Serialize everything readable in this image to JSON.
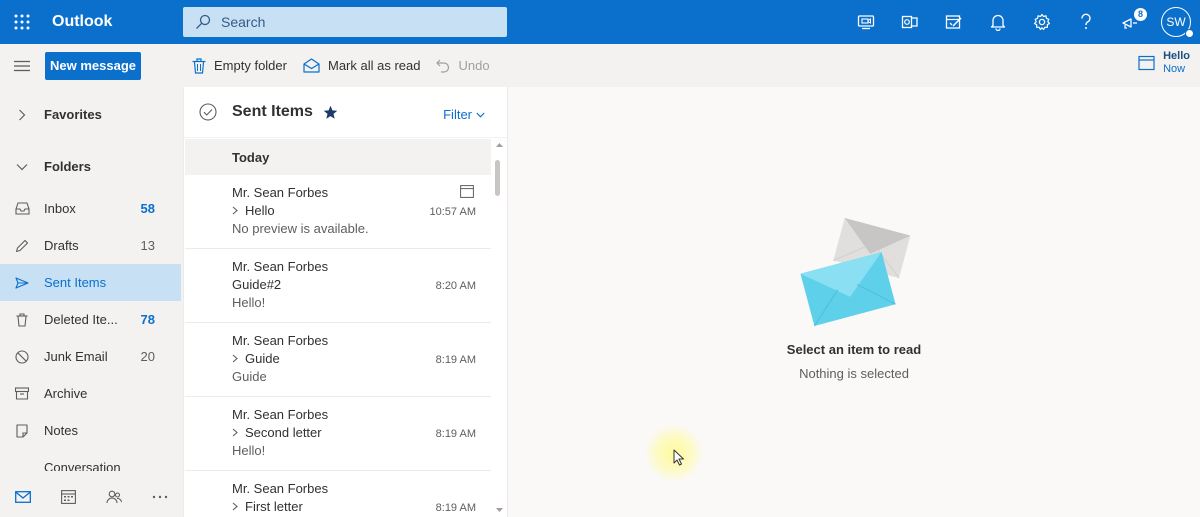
{
  "app": {
    "title": "Outlook"
  },
  "search": {
    "placeholder": "Search"
  },
  "topbar": {
    "notifications_badge": "8",
    "avatar_initials": "SW"
  },
  "toolbar": {
    "new_message": "New message",
    "empty_folder": "Empty folder",
    "mark_all_read": "Mark all as read",
    "undo": "Undo",
    "calendar_title": "Hello",
    "calendar_time": "Now"
  },
  "nav": {
    "favorites": "Favorites",
    "folders": "Folders",
    "items": [
      {
        "label": "Inbox",
        "count": "58",
        "bold": true
      },
      {
        "label": "Drafts",
        "count": "13",
        "bold": false
      },
      {
        "label": "Sent Items",
        "count": "",
        "bold": false,
        "selected": true
      },
      {
        "label": "Deleted Ite...",
        "count": "78",
        "bold": true
      },
      {
        "label": "Junk Email",
        "count": "20",
        "bold": false
      },
      {
        "label": "Archive",
        "count": "",
        "bold": false
      },
      {
        "label": "Notes",
        "count": "",
        "bold": false
      },
      {
        "label": "Conversation ...",
        "count": "",
        "bold": false
      }
    ]
  },
  "list": {
    "title": "Sent Items",
    "filter": "Filter",
    "group": "Today",
    "messages": [
      {
        "from": "Mr. Sean Forbes",
        "subject": "Hello",
        "preview": "No preview is available.",
        "time": "10:57 AM",
        "thread": true,
        "calendar": true
      },
      {
        "from": "Mr. Sean Forbes",
        "subject": "Guide#2",
        "preview": "Hello!",
        "time": "8:20 AM",
        "thread": false
      },
      {
        "from": "Mr. Sean Forbes",
        "subject": "Guide",
        "preview": "Guide",
        "time": "8:19 AM",
        "thread": true
      },
      {
        "from": "Mr. Sean Forbes",
        "subject": "Second letter",
        "preview": "Hello!",
        "time": "8:19 AM",
        "thread": true
      },
      {
        "from": "Mr. Sean Forbes",
        "subject": "First letter",
        "preview": "",
        "time": "8:19 AM",
        "thread": true
      }
    ]
  },
  "reading": {
    "title": "Select an item to read",
    "subtitle": "Nothing is selected"
  },
  "colors": {
    "brand": "#0b6fcc",
    "selected": "#c7e0f4",
    "envelope_front": "#5fd0ea",
    "envelope_back": "#d2d0ce"
  }
}
